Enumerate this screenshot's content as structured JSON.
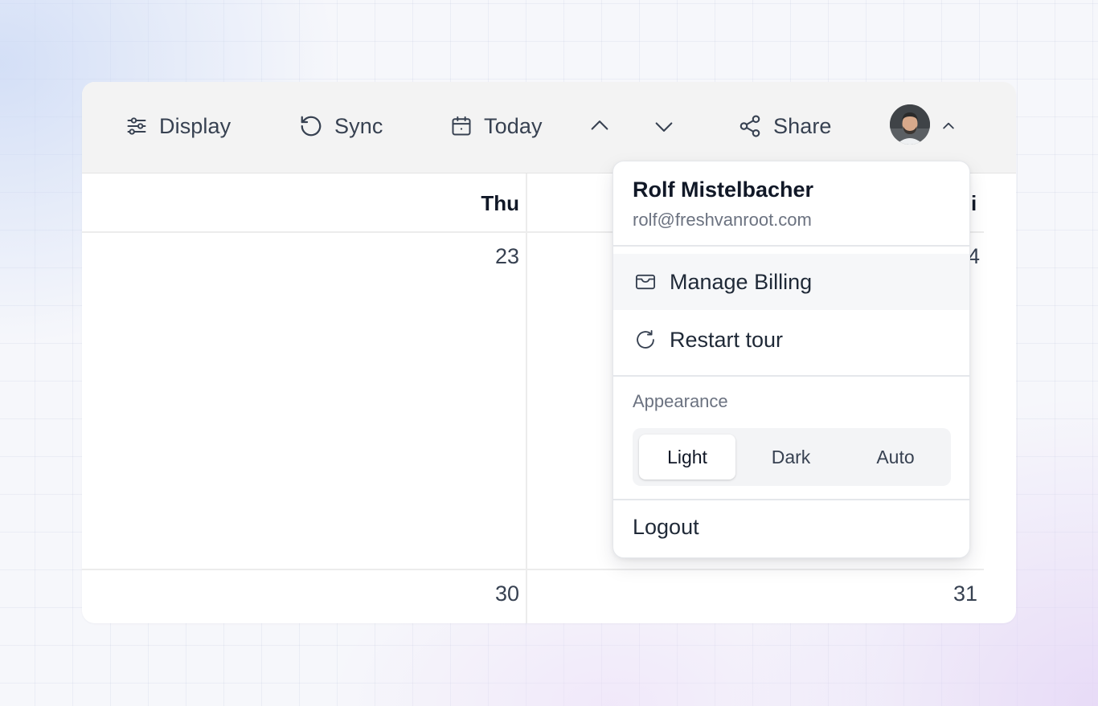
{
  "toolbar": {
    "display_label": "Display",
    "sync_label": "Sync",
    "today_label": "Today",
    "share_label": "Share"
  },
  "calendar": {
    "day_headers": [
      "Thu",
      "i"
    ],
    "dates_row1": [
      "23",
      "4"
    ],
    "dates_row2": [
      "30",
      "31"
    ]
  },
  "user_menu": {
    "name": "Rolf Mistelbacher",
    "email": "rolf@freshvanroot.com",
    "items": [
      {
        "label": "Manage Billing",
        "icon": "wallet-icon"
      },
      {
        "label": "Restart tour",
        "icon": "refresh-icon"
      }
    ],
    "appearance": {
      "label": "Appearance",
      "options": [
        "Light",
        "Dark",
        "Auto"
      ],
      "selected": "Light"
    },
    "logout_label": "Logout"
  },
  "colors": {
    "text_primary": "#111827",
    "text_secondary": "#6b7280",
    "toolbar_bg": "#f3f3f3",
    "hover_bg": "#f6f7f9"
  }
}
